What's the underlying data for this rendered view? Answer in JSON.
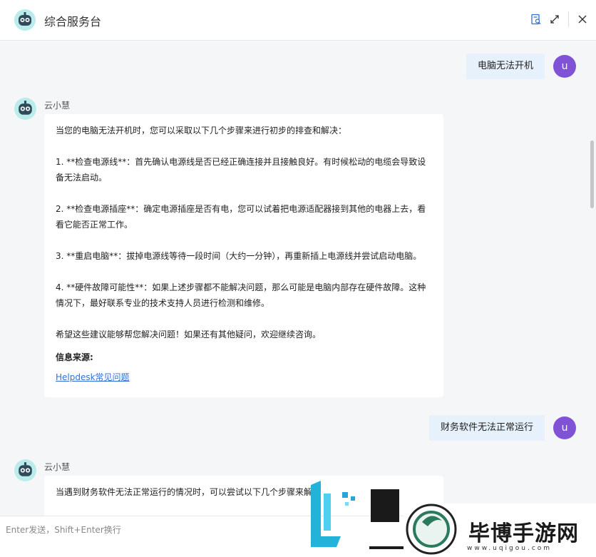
{
  "header": {
    "title": "综合服务台"
  },
  "messages": [
    {
      "role": "user",
      "avatar": "u",
      "text": "电脑无法开机"
    },
    {
      "role": "bot",
      "name": "云小慧",
      "paragraphs": [
        "当您的电脑无法开机时，您可以采取以下几个步骤来进行初步的排查和解决：",
        "1. **检查电源线**：首先确认电源线是否已经正确连接并且接触良好。有时候松动的电缆会导致设备无法启动。",
        "2. **检查电源插座**：确定电源插座是否有电，您可以试着把电源适配器接到其他的电器上去，看看它能否正常工作。",
        "3. **重启电脑**：拔掉电源线等待一段时间（大约一分钟），再重新插上电源线并尝试启动电脑。",
        "4. **硬件故障可能性**：如果上述步骤都不能解决问题，那么可能是电脑内部存在硬件故障。这种情况下，最好联系专业的技术支持人员进行检测和维修。",
        "希望这些建议能够帮您解决问题！如果还有其他疑问，欢迎继续咨询。"
      ],
      "source_title": "信息来源:",
      "source_link": "Helpdesk常见问题"
    },
    {
      "role": "user",
      "avatar": "u",
      "text": "财务软件无法正常运行"
    },
    {
      "role": "bot",
      "name": "云小慧",
      "paragraphs": [
        "当遇到财务软件无法正常运行的情况时，可以尝试以下几个步骤来解"
      ]
    }
  ],
  "input": {
    "placeholder": "Enter发送，Shift+Enter换行"
  },
  "watermark": {
    "text": "毕博手游网",
    "url": "www.uqigou.com"
  },
  "colors": {
    "user_avatar": "#7f52d6",
    "user_bubble": "#e7f1fb",
    "link": "#2f6fdc",
    "accent_icon": "#2f6fdc"
  }
}
